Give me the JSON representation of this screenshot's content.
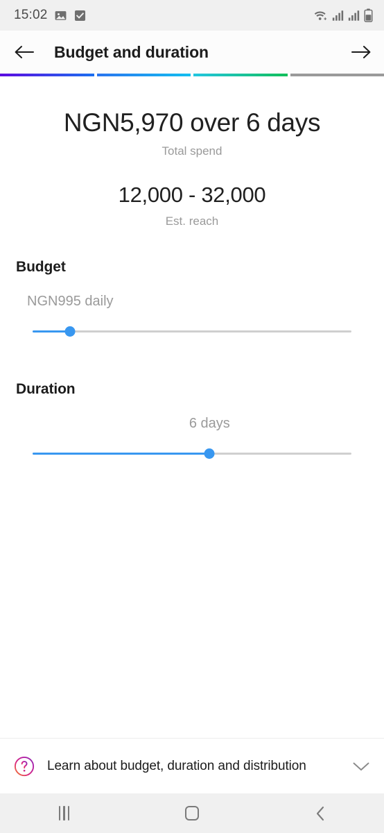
{
  "status_bar": {
    "time": "15:02",
    "left_icons": [
      "image-icon",
      "checkbox-checked-icon"
    ],
    "right_icons": [
      "wifi-icon",
      "signal-sim1-icon",
      "signal-sim2-icon",
      "battery-icon"
    ],
    "battery_level_pct": 55,
    "background": "#f0f0f0"
  },
  "header": {
    "back_icon": "arrow-left-icon",
    "title": "Budget and duration",
    "forward_icon": "arrow-right-icon"
  },
  "progress": {
    "segments": [
      {
        "name": "step-1",
        "state": "complete",
        "color_from": "#5b0ae0",
        "color_to": "#1a6ff0"
      },
      {
        "name": "step-2",
        "state": "complete",
        "color_from": "#2a74ef",
        "color_to": "#12bef0"
      },
      {
        "name": "step-3",
        "state": "complete",
        "color_from": "#22c6e0",
        "color_to": "#11bf5a"
      },
      {
        "name": "step-4",
        "state": "incomplete",
        "color_from": "#9a9a9a",
        "color_to": "#9a9a9a"
      }
    ]
  },
  "summary": {
    "total_spend_value": "NGN5,970 over 6 days",
    "total_spend_label": "Total spend",
    "reach_value": "12,000 - 32,000",
    "reach_label": "Est. reach"
  },
  "budget": {
    "section_label": "Budget",
    "value_text": "NGN995 daily",
    "slider_percent": 11.8,
    "accent_color": "#3897f0",
    "track_color": "#cfcfcf"
  },
  "duration": {
    "section_label": "Duration",
    "value_text": "6 days",
    "slider_percent": 55.5,
    "accent_color": "#3897f0",
    "track_color": "#cfcfcf"
  },
  "footer": {
    "help_icon": "question-mark-circle-icon",
    "text": "Learn about budget, duration and distribution",
    "expand_icon": "chevron-down-icon"
  },
  "navbar": {
    "recents_icon": "recents-icon",
    "home_icon": "home-icon",
    "back_icon": "chevron-left-icon"
  }
}
